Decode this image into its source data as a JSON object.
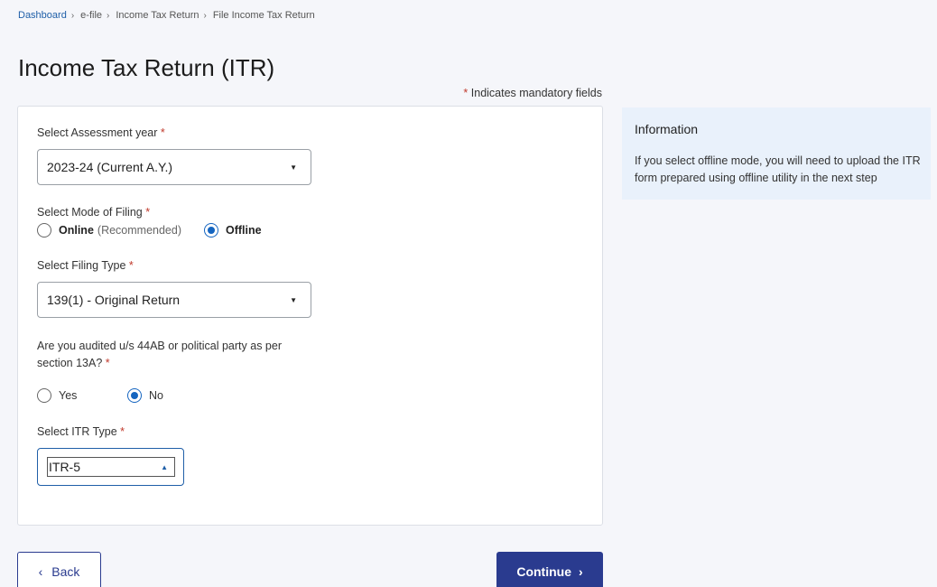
{
  "breadcrumb": [
    {
      "label": "Dashboard",
      "link": true
    },
    {
      "label": "e-file",
      "link": false
    },
    {
      "label": "Income Tax Return",
      "link": false
    },
    {
      "label": "File Income Tax Return",
      "link": false
    }
  ],
  "breadcrumb_sep": "›",
  "page_title": "Income Tax Return (ITR)",
  "mandatory_note": {
    "asterisk": "*",
    "text": " Indicates mandatory fields"
  },
  "form": {
    "assessment_year": {
      "label": "Select Assessment year ",
      "required": "*",
      "value": "2023-24 (Current A.Y.)",
      "caret": "▼"
    },
    "mode_of_filing": {
      "label": "Select Mode of Filing  ",
      "required": "*",
      "options": [
        {
          "label": "Online",
          "hint": "(Recommended)",
          "checked": false
        },
        {
          "label": "Offline",
          "checked": true
        }
      ]
    },
    "filing_type": {
      "label": "Select Filing Type ",
      "required": "*",
      "value": "139(1) - Original Return",
      "caret": "▼"
    },
    "audited": {
      "label_line1": "Are you audited u/s 44AB or political party as per",
      "label_line2": "section 13A? ",
      "required": "*",
      "options": [
        {
          "label": "Yes",
          "checked": false
        },
        {
          "label": "No",
          "checked": true
        }
      ]
    },
    "itr_type": {
      "label": "Select ITR Type ",
      "required": "*",
      "value": "ITR-5",
      "caret": "▲"
    }
  },
  "info": {
    "title": "Information",
    "text": "If you select offline mode, you will need to upload the ITR form prepared using offline utility in the next step"
  },
  "buttons": {
    "back": "Back",
    "continue": "Continue",
    "back_icon": "‹",
    "continue_icon": "›"
  },
  "colors": {
    "primary": "#2a3b8f",
    "link": "#1f5fa8",
    "radio": "#1565c0",
    "required": "#c0392b",
    "info_bg": "#e9f1fb"
  }
}
